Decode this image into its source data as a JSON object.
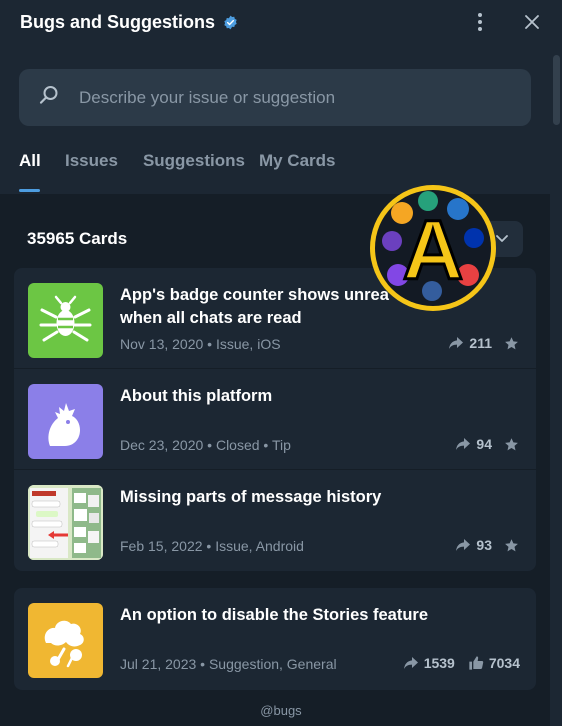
{
  "header": {
    "title": "Bugs and Suggestions"
  },
  "search": {
    "placeholder": "Describe your issue or suggestion"
  },
  "tabs": [
    {
      "label": "All",
      "active": true
    },
    {
      "label": "Issues",
      "active": false
    },
    {
      "label": "Suggestions",
      "active": false
    },
    {
      "label": "My Cards",
      "active": false
    }
  ],
  "list": {
    "count_label": "35965 Cards"
  },
  "cards": [
    {
      "title": "App's badge counter shows unread messages when all chats are read",
      "title_visible": "App's badge counter shows unrea",
      "title_line2": "when all chats are read",
      "meta": "Nov 13, 2020 • Issue, iOS",
      "shares": "211",
      "thumb_color": "#6cc644",
      "thumb_icon": "bug-icon"
    },
    {
      "title": "About this platform",
      "meta": "Dec 23, 2020 • Closed • Tip",
      "shares": "94",
      "thumb_color": "#8b7fe8",
      "thumb_icon": "rooster-icon"
    },
    {
      "title": "Missing parts of message history",
      "meta": "Feb 15, 2022 • Issue, Android",
      "shares": "93",
      "thumb_icon": "screenshot-thumbnail"
    },
    {
      "title": "An option to disable the Stories feature",
      "meta": "Jul 21, 2023 • Suggestion, General",
      "shares": "1539",
      "likes": "7034",
      "thumb_color": "#f0b732",
      "thumb_icon": "stories-icon"
    }
  ],
  "footer": {
    "handle": "@bugs"
  },
  "overlay": {
    "letter": "A"
  },
  "colors": {
    "background": "#1c2733",
    "content_background": "#151e27",
    "accent": "#4d9de0",
    "muted_text": "#8997a5"
  }
}
